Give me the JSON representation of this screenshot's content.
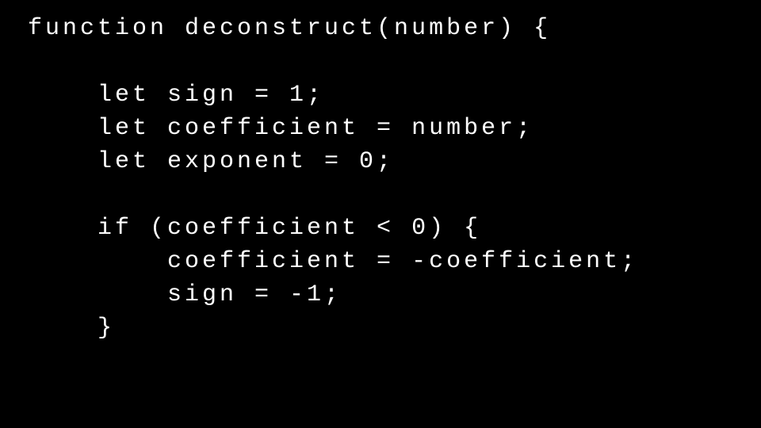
{
  "code": {
    "line1": "function deconstruct(number) {",
    "line2": "    let sign = 1;",
    "line3": "    let coefficient = number;",
    "line4": "    let exponent = 0;",
    "line5": "    if (coefficient < 0) {",
    "line6": "        coefficient = -coefficient;",
    "line7": "        sign = -1;",
    "line8": "    }"
  }
}
